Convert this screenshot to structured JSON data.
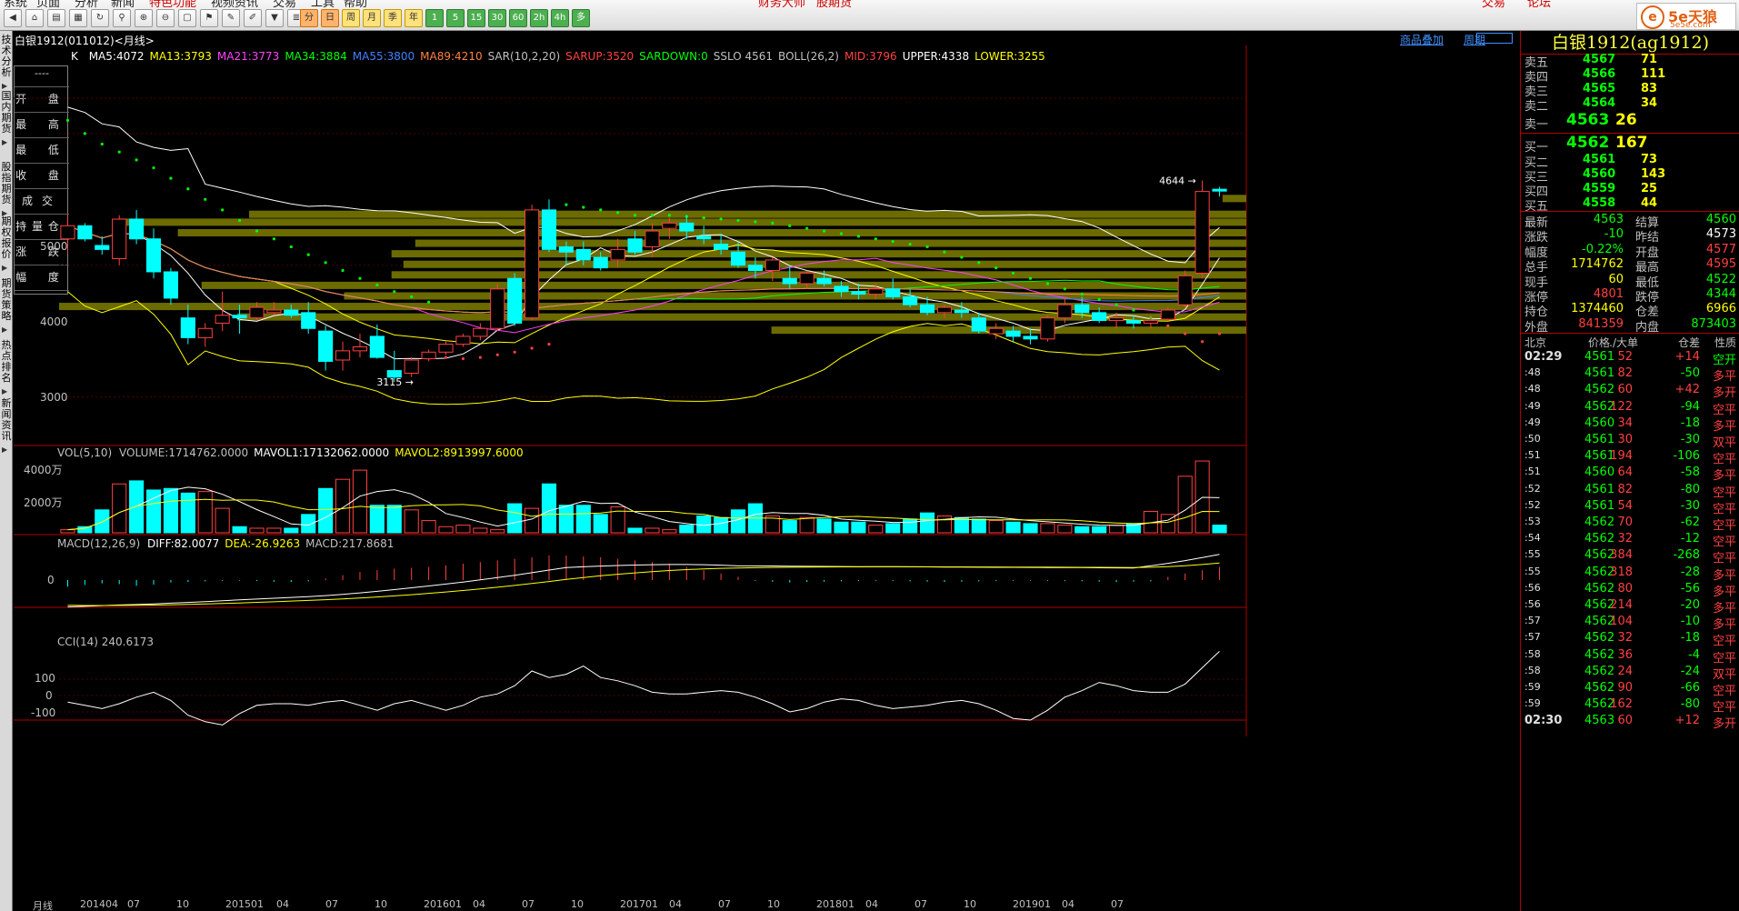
{
  "toolbar": {
    "menus": [
      "系统",
      "页面",
      "分析",
      "新闻",
      "特色功能",
      "视频资讯",
      "交易",
      "工具",
      "帮助",
      "财务大师",
      "股期货"
    ],
    "menu_red": [
      false,
      false,
      false,
      false,
      true,
      false,
      false,
      false,
      false,
      true,
      true
    ],
    "period_buttons": [
      "分",
      "日",
      "周",
      "月",
      "季",
      "年",
      "1",
      "5",
      "15",
      "30",
      "60",
      "2h",
      "4h",
      "多"
    ],
    "right_buttons": [
      "交易",
      "论坛"
    ]
  },
  "logo": {
    "brand": "5e天狼",
    "url": "5e5e.com"
  },
  "left_tabs": [
    "技术分析",
    "国内期货",
    "股指期货",
    "期权报价",
    "期货策略",
    "热点排名",
    "新闻资讯"
  ],
  "info_box": [
    "----",
    "开 盘",
    "最 高",
    "最 低",
    "收 盘",
    "成交量",
    "持 仓",
    "涨 跌",
    "幅 度"
  ],
  "chart": {
    "title": "白银1912(011012)<月线>",
    "k_label": "K",
    "ma_items": [
      {
        "text": "MA5:4072",
        "color": "#ffffff"
      },
      {
        "text": "MA13:3793",
        "color": "#ffff00"
      },
      {
        "text": "MA21:3773",
        "color": "#ff40ff"
      },
      {
        "text": "MA34:3884",
        "color": "#00ff00"
      },
      {
        "text": "MA55:3800",
        "color": "#4080ff"
      },
      {
        "text": "MA89:4210",
        "color": "#ff8040"
      },
      {
        "text": "SAR(10,2,20)",
        "color": "#c0c0c0"
      },
      {
        "text": "SARUP:3520",
        "color": "#ff4040"
      },
      {
        "text": "SARDOWN:0",
        "color": "#00ff00"
      },
      {
        "text": "SSLO 4561",
        "color": "#c0c0c0"
      },
      {
        "text": "BOLL(26,2)",
        "color": "#c0c0c0"
      },
      {
        "text": "MID:3796",
        "color": "#ff4040"
      },
      {
        "text": "UPPER:4338",
        "color": "#ffffff"
      },
      {
        "text": "LOWER:3255",
        "color": "#ffff00"
      }
    ],
    "links": [
      "商品叠加",
      "周期"
    ],
    "y_labels": [
      "5000",
      "4000",
      "3000"
    ],
    "marker_high": "4644",
    "marker_low": "3115",
    "vol_label": "VOL(5,10)",
    "vol_items": [
      {
        "text": "VOLUME:1714762.0000",
        "color": "#c0c0c0"
      },
      {
        "text": "MAVOL1:17132062.0000",
        "color": "#ffffff"
      },
      {
        "text": "MAVOL2:8913997.6000",
        "color": "#ffff00"
      }
    ],
    "vol_y": [
      "4000万",
      "2000万"
    ],
    "macd_label": "MACD(12,26,9)",
    "macd_items": [
      {
        "text": "DIFF:82.0077",
        "color": "#ffffff"
      },
      {
        "text": "DEA:-26.9263",
        "color": "#ffff00"
      },
      {
        "text": "MACD:217.8681",
        "color": "#c0c0c0"
      }
    ],
    "macd_y": [
      "0"
    ],
    "cci_label": "CCI(14) 240.6173",
    "cci_y": [
      "100",
      "0",
      "-100"
    ],
    "x_labels": [
      "月线",
      "201404",
      "07",
      "10",
      "201501",
      "04",
      "07",
      "10",
      "201601",
      "04",
      "07",
      "10",
      "201701",
      "04",
      "07",
      "10",
      "201801",
      "04",
      "07",
      "10",
      "201901",
      "04",
      "07"
    ],
    "chart_data": {
      "type": "candlestick",
      "period": "monthly",
      "x": [
        "201404",
        "07",
        "10",
        "201501",
        "04",
        "07",
        "10",
        "201601",
        "04",
        "07",
        "10",
        "201701",
        "04",
        "07",
        "10",
        "201801",
        "04",
        "07",
        "10",
        "201901",
        "04",
        "07"
      ],
      "last": {
        "MA5": 4072,
        "MA13": 3793,
        "MA21": 3773,
        "MA34": 3884,
        "MA55": 3800,
        "MA89": 4210,
        "SARUP": 3520,
        "SARDOWN": 0,
        "SSLO": 4561,
        "MID": 3796,
        "UPPER": 4338,
        "LOWER": 3255
      },
      "ylim": [
        2700,
        5600
      ],
      "high_mark": 4644,
      "low_mark": 3115,
      "candles": [
        [
          4200,
          4380,
          4100,
          4300
        ],
        [
          4300,
          4320,
          4180,
          4200
        ],
        [
          4150,
          4220,
          4080,
          4120
        ],
        [
          4050,
          4380,
          4000,
          4350
        ],
        [
          4350,
          4420,
          4160,
          4200
        ],
        [
          4200,
          4280,
          3900,
          3950
        ],
        [
          3950,
          3980,
          3700,
          3750
        ],
        [
          3600,
          3700,
          3400,
          3450
        ],
        [
          3450,
          3560,
          3380,
          3520
        ],
        [
          3560,
          3800,
          3500,
          3620
        ],
        [
          3620,
          3700,
          3480,
          3600
        ],
        [
          3600,
          3720,
          3580,
          3680
        ],
        [
          3640,
          3720,
          3620,
          3660
        ],
        [
          3660,
          3700,
          3600,
          3620
        ],
        [
          3640,
          3720,
          3480,
          3520
        ],
        [
          3500,
          3540,
          3200,
          3270
        ],
        [
          3280,
          3420,
          3200,
          3350
        ],
        [
          3350,
          3480,
          3300,
          3380
        ],
        [
          3460,
          3550,
          3290,
          3300
        ],
        [
          3200,
          3350,
          3115,
          3150
        ],
        [
          3180,
          3300,
          3150,
          3280
        ],
        [
          3290,
          3360,
          3270,
          3340
        ],
        [
          3340,
          3420,
          3320,
          3400
        ],
        [
          3400,
          3480,
          3380,
          3460
        ],
        [
          3460,
          3560,
          3430,
          3520
        ],
        [
          3520,
          3860,
          3500,
          3820
        ],
        [
          3900,
          3940,
          3540,
          3560
        ],
        [
          3600,
          4460,
          3580,
          4420
        ],
        [
          4420,
          4500,
          4100,
          4120
        ],
        [
          4140,
          4180,
          4000,
          4100
        ],
        [
          4120,
          4180,
          4000,
          4040
        ],
        [
          4060,
          4100,
          3960,
          3980
        ],
        [
          4040,
          4200,
          3980,
          4120
        ],
        [
          4200,
          4260,
          4080,
          4100
        ],
        [
          4140,
          4320,
          4060,
          4260
        ],
        [
          4280,
          4360,
          4200,
          4320
        ],
        [
          4320,
          4380,
          4200,
          4260
        ],
        [
          4220,
          4300,
          4160,
          4200
        ],
        [
          4160,
          4240,
          4080,
          4120
        ],
        [
          4100,
          4180,
          3980,
          4000
        ],
        [
          4000,
          4060,
          3900,
          3960
        ],
        [
          3960,
          4060,
          3880,
          4040
        ],
        [
          3900,
          4000,
          3820,
          3860
        ],
        [
          3860,
          3960,
          3820,
          3940
        ],
        [
          3900,
          3960,
          3840,
          3860
        ],
        [
          3840,
          3880,
          3760,
          3800
        ],
        [
          3800,
          3860,
          3740,
          3780
        ],
        [
          3780,
          3860,
          3740,
          3820
        ],
        [
          3820,
          3900,
          3740,
          3760
        ],
        [
          3760,
          3820,
          3680,
          3700
        ],
        [
          3700,
          3760,
          3620,
          3640
        ],
        [
          3640,
          3700,
          3600,
          3680
        ],
        [
          3660,
          3720,
          3600,
          3640
        ],
        [
          3600,
          3640,
          3480,
          3500
        ],
        [
          3480,
          3560,
          3440,
          3520
        ],
        [
          3500,
          3540,
          3420,
          3460
        ],
        [
          3460,
          3520,
          3400,
          3440
        ],
        [
          3440,
          3620,
          3420,
          3600
        ],
        [
          3600,
          3760,
          3560,
          3700
        ],
        [
          3700,
          3760,
          3600,
          3640
        ],
        [
          3640,
          3680,
          3560,
          3580
        ],
        [
          3580,
          3640,
          3520,
          3600
        ],
        [
          3580,
          3620,
          3520,
          3560
        ],
        [
          3560,
          3620,
          3520,
          3580
        ],
        [
          3590,
          3680,
          3580,
          3660
        ],
        [
          3700,
          3960,
          3680,
          3920
        ],
        [
          3940,
          4644,
          3900,
          4560
        ],
        [
          4577,
          4595,
          4522,
          4563
        ]
      ],
      "volume_wan": [
        200,
        400,
        1500,
        3200,
        3400,
        2800,
        2900,
        2600,
        2700,
        1600,
        400,
        300,
        300,
        300,
        1200,
        2900,
        3500,
        4100,
        1800,
        1800,
        1500,
        800,
        400,
        500,
        300,
        200,
        1900,
        1600,
        3200,
        1800,
        1800,
        1200,
        1700,
        300,
        300,
        200,
        500,
        1100,
        1000,
        1500,
        1900,
        1100,
        800,
        1000,
        900,
        700,
        700,
        500,
        600,
        900,
        1300,
        1100,
        1000,
        900,
        800,
        700,
        600,
        600,
        500,
        400,
        400,
        500,
        600,
        1400,
        1200,
        3700,
        4700,
        500
      ],
      "macd_bar": [
        -40,
        -30,
        -20,
        -25,
        -35,
        -28,
        -15,
        -12,
        -8,
        -5,
        -4,
        -6,
        -10,
        -12,
        -8,
        10,
        30,
        50,
        60,
        70,
        75,
        80,
        90,
        100,
        110,
        120,
        130,
        140,
        150,
        150,
        145,
        140,
        130,
        120,
        110,
        100,
        80,
        60,
        40,
        20,
        -5,
        -10,
        -15,
        -12,
        -10,
        -8,
        -6,
        -5,
        -6,
        -8,
        -10,
        -12,
        -10,
        -8,
        -6,
        -5,
        -4,
        -5,
        -6,
        -8,
        -10,
        -12,
        -10,
        -8,
        20,
        40,
        60,
        80,
        110
      ],
      "cci": [
        -40,
        -60,
        -80,
        -50,
        -10,
        20,
        -30,
        -120,
        -160,
        -180,
        -110,
        -60,
        -50,
        -50,
        -60,
        -40,
        -30,
        -60,
        -90,
        -50,
        -30,
        -60,
        -90,
        -60,
        -10,
        10,
        60,
        150,
        110,
        130,
        180,
        110,
        90,
        60,
        20,
        10,
        10,
        20,
        30,
        20,
        -10,
        -50,
        -100,
        -80,
        -40,
        -20,
        -30,
        -60,
        -80,
        -70,
        -60,
        -40,
        -30,
        -50,
        -90,
        -140,
        -150,
        -90,
        -10,
        30,
        80,
        60,
        30,
        20,
        20,
        70,
        170,
        270,
        240
      ]
    }
  },
  "right_panel": {
    "title": "白银1912(ag1912)",
    "asks": [
      {
        "label": "卖五",
        "price": "4567",
        "vol": "71"
      },
      {
        "label": "卖四",
        "price": "4566",
        "vol": "111"
      },
      {
        "label": "卖三",
        "price": "4565",
        "vol": "83"
      },
      {
        "label": "卖二",
        "price": "4564",
        "vol": "34"
      }
    ],
    "ask1": {
      "label": "卖一",
      "price": "4563",
      "vol": "26"
    },
    "bid1": {
      "label": "买一",
      "price": "4562",
      "vol": "167"
    },
    "bids": [
      {
        "label": "买二",
        "price": "4561",
        "vol": "73"
      },
      {
        "label": "买三",
        "price": "4560",
        "vol": "143"
      },
      {
        "label": "买四",
        "price": "4559",
        "vol": "25"
      },
      {
        "label": "买五",
        "price": "4558",
        "vol": "44"
      }
    ],
    "quotes": [
      {
        "l1": "最新",
        "v1": "4563",
        "c1": "#00ff00",
        "l2": "结算",
        "v2": "4560",
        "c2": "#00ff00"
      },
      {
        "l1": "涨跌",
        "v1": "-10",
        "c1": "#00ff00",
        "l2": "昨结",
        "v2": "4573",
        "c2": "#ffffff"
      },
      {
        "l1": "幅度",
        "v1": "-0.22%",
        "c1": "#00ff00",
        "l2": "开盘",
        "v2": "4577",
        "c2": "#ff4040"
      },
      {
        "l1": "总手",
        "v1": "1714762",
        "c1": "#ffff00",
        "l2": "最高",
        "v2": "4595",
        "c2": "#ff4040"
      },
      {
        "l1": "现手",
        "v1": "60",
        "c1": "#ffff00",
        "l2": "最低",
        "v2": "4522",
        "c2": "#00ff00"
      },
      {
        "l1": "涨停",
        "v1": "4801",
        "c1": "#ff4040",
        "l2": "跌停",
        "v2": "4344",
        "c2": "#00ff00"
      },
      {
        "l1": "持仓",
        "v1": "1374460",
        "c1": "#ffff00",
        "l2": "仓差",
        "v2": "6966",
        "c2": "#ffff00"
      },
      {
        "l1": "外盘",
        "v1": "841359",
        "c1": "#ff4040",
        "l2": "内盘",
        "v2": "873403",
        "c2": "#00ff00"
      }
    ],
    "ticks_header": {
      "city": "北京",
      "price": "价格",
      "vol": "./大单",
      "chg": "仓差",
      "nat": "性质"
    },
    "ticks": [
      {
        "t": "02:29",
        "p": "4561",
        "v": "52",
        "c": "+14",
        "cc": "#ff4040",
        "n": "空开",
        "nc": "#00ff00"
      },
      {
        "t": ":48",
        "p": "4561",
        "v": "82",
        "c": "-50",
        "cc": "#00ff00",
        "n": "多平",
        "nc": "#ff4040"
      },
      {
        "t": ":48",
        "p": "4562",
        "v": "60",
        "c": "+42",
        "cc": "#ff4040",
        "n": "多开",
        "nc": "#ff4040"
      },
      {
        "t": ":49",
        "p": "4562",
        "v": "122",
        "c": "-94",
        "cc": "#00ff00",
        "n": "空平",
        "nc": "#ff4040"
      },
      {
        "t": ":49",
        "p": "4560",
        "v": "34",
        "c": "-18",
        "cc": "#00ff00",
        "n": "多平",
        "nc": "#ff4040"
      },
      {
        "t": ":50",
        "p": "4561",
        "v": "30",
        "c": "-30",
        "cc": "#00ff00",
        "n": "双平",
        "nc": "#ff4040"
      },
      {
        "t": ":51",
        "p": "4561",
        "v": "194",
        "c": "-106",
        "cc": "#00ff00",
        "n": "空平",
        "nc": "#ff4040"
      },
      {
        "t": ":51",
        "p": "4560",
        "v": "64",
        "c": "-58",
        "cc": "#00ff00",
        "n": "多平",
        "nc": "#ff4040"
      },
      {
        "t": ":52",
        "p": "4561",
        "v": "82",
        "c": "-80",
        "cc": "#00ff00",
        "n": "空平",
        "nc": "#ff4040"
      },
      {
        "t": ":52",
        "p": "4561",
        "v": "54",
        "c": "-30",
        "cc": "#00ff00",
        "n": "空平",
        "nc": "#ff4040"
      },
      {
        "t": ":53",
        "p": "4562",
        "v": "70",
        "c": "-62",
        "cc": "#00ff00",
        "n": "空平",
        "nc": "#ff4040"
      },
      {
        "t": ":54",
        "p": "4562",
        "v": "32",
        "c": "-12",
        "cc": "#00ff00",
        "n": "空平",
        "nc": "#ff4040"
      },
      {
        "t": ":55",
        "p": "4562",
        "v": "384",
        "c": "-268",
        "cc": "#00ff00",
        "n": "空平",
        "nc": "#ff4040"
      },
      {
        "t": ":55",
        "p": "4562",
        "v": "318",
        "c": "-28",
        "cc": "#00ff00",
        "n": "多平",
        "nc": "#ff4040"
      },
      {
        "t": ":56",
        "p": "4562",
        "v": "80",
        "c": "-56",
        "cc": "#00ff00",
        "n": "多平",
        "nc": "#ff4040"
      },
      {
        "t": ":56",
        "p": "4562",
        "v": "214",
        "c": "-20",
        "cc": "#00ff00",
        "n": "多平",
        "nc": "#ff4040"
      },
      {
        "t": ":57",
        "p": "4562",
        "v": "104",
        "c": "-10",
        "cc": "#00ff00",
        "n": "多平",
        "nc": "#ff4040"
      },
      {
        "t": ":57",
        "p": "4562",
        "v": "32",
        "c": "-18",
        "cc": "#00ff00",
        "n": "空平",
        "nc": "#ff4040"
      },
      {
        "t": ":58",
        "p": "4562",
        "v": "36",
        "c": "-4",
        "cc": "#00ff00",
        "n": "空平",
        "nc": "#ff4040"
      },
      {
        "t": ":58",
        "p": "4562",
        "v": "24",
        "c": "-24",
        "cc": "#00ff00",
        "n": "双平",
        "nc": "#ff4040"
      },
      {
        "t": ":59",
        "p": "4562",
        "v": "90",
        "c": "-66",
        "cc": "#00ff00",
        "n": "空平",
        "nc": "#ff4040"
      },
      {
        "t": ":59",
        "p": "4562",
        "v": "162",
        "c": "-80",
        "cc": "#00ff00",
        "n": "空平",
        "nc": "#ff4040"
      },
      {
        "t": "02:30",
        "p": "4563",
        "v": "60",
        "c": "+12",
        "cc": "#ff4040",
        "n": "多开",
        "nc": "#ff4040"
      }
    ]
  }
}
